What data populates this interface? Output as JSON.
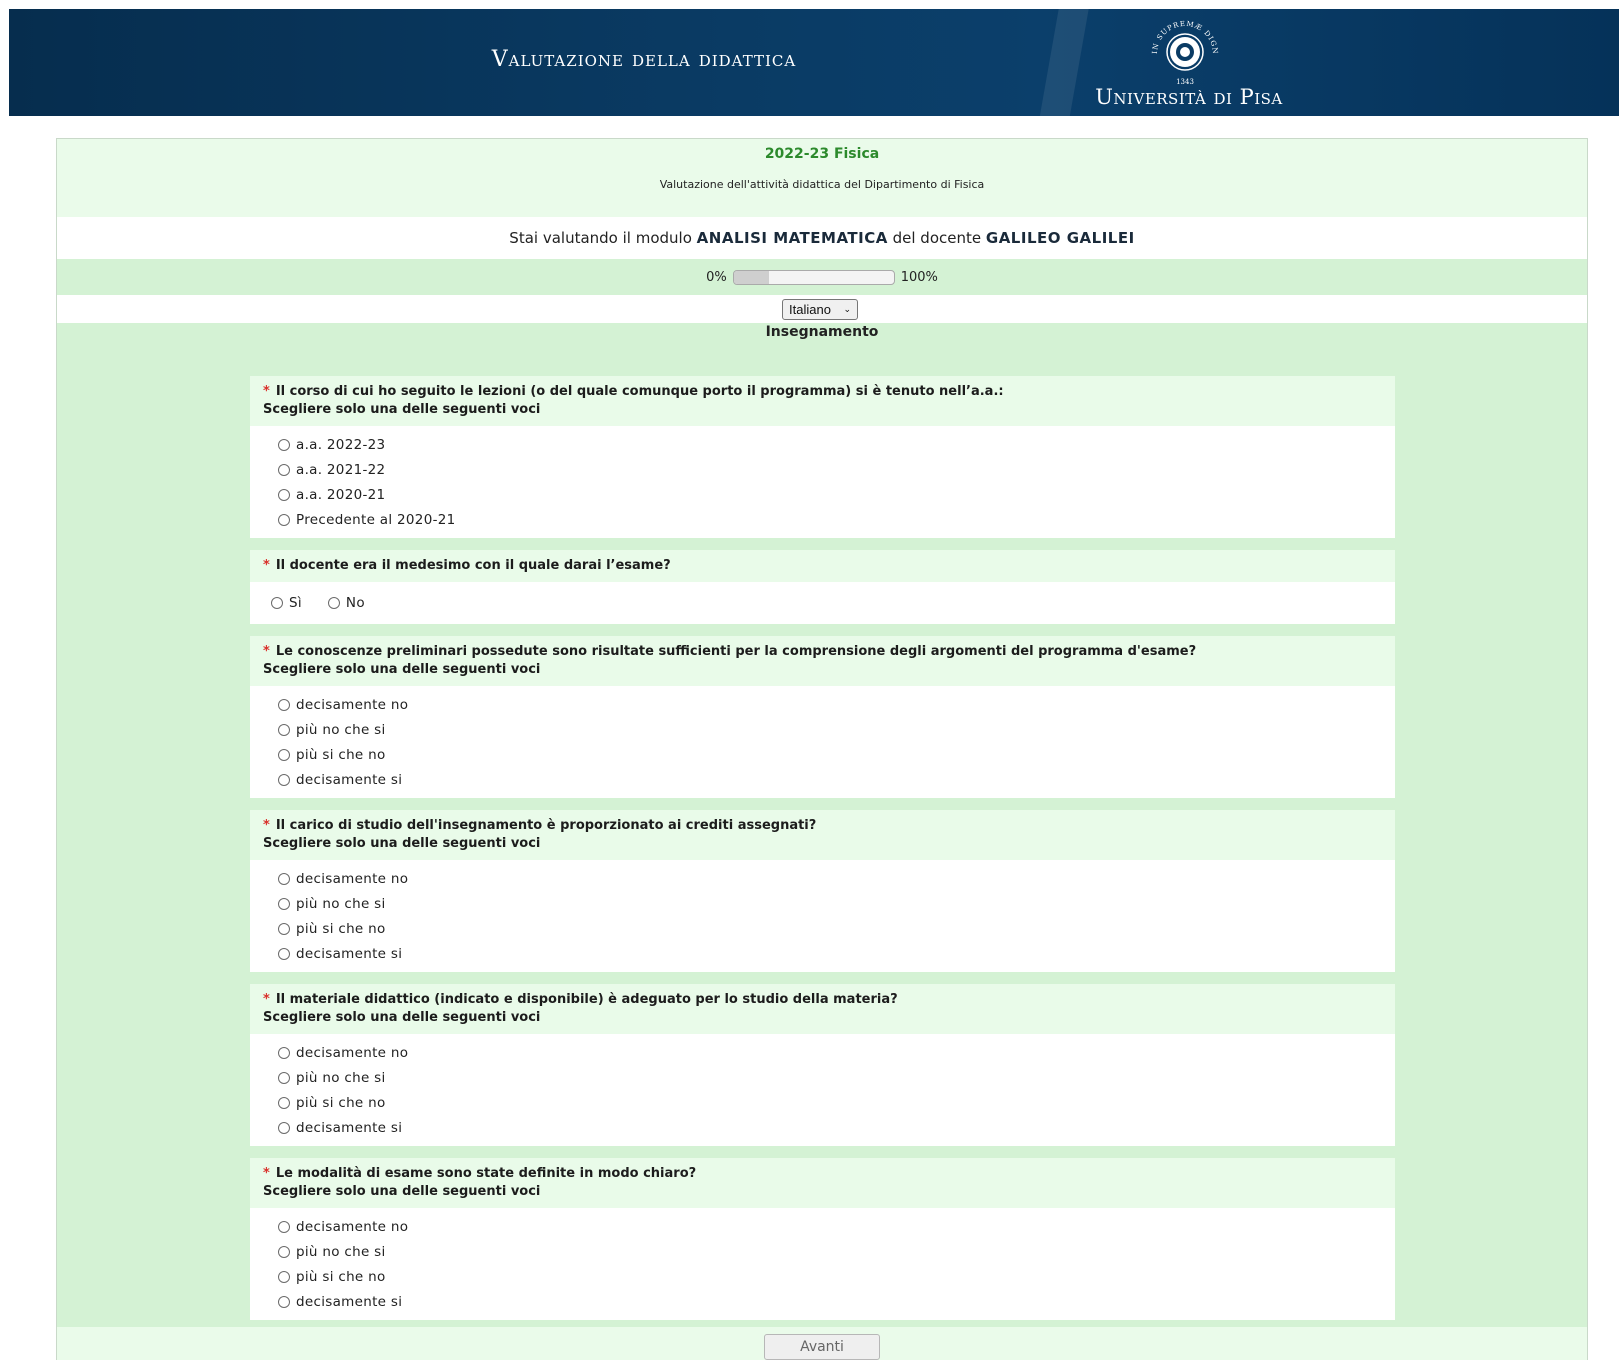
{
  "header": {
    "title": "Valutazione della didattica",
    "university": "Università di Pisa",
    "logo_motto": "IN SUPREMÆ DIGNITATIS",
    "logo_year": "1343"
  },
  "top": {
    "year_course": "2022-23 Fisica",
    "description": "Valutazione dell'attività didattica del Dipartimento di Fisica"
  },
  "evaluation": {
    "prefix": "Stai valutando il modulo",
    "module": "ANALISI MATEMATICA",
    "middle": "del docente",
    "teacher": "GALILEO GALILEI"
  },
  "progress": {
    "start_label": "0%",
    "end_label": "100%",
    "value": 0.22
  },
  "language": {
    "selected": "Italiano"
  },
  "section": {
    "title": "Insegnamento"
  },
  "questions": [
    {
      "text": "Il corso di cui  ho seguito le lezioni (o del quale comunque porto il programma) si è tenuto nell’a.a.:",
      "hint": "Scegliere solo una delle seguenti voci",
      "options": [
        "a.a. 2022-23",
        "a.a. 2021-22",
        "a.a. 2020-21",
        "Precedente al 2020-21"
      ]
    },
    {
      "text": "Il docente era il medesimo con il quale darai l’esame?",
      "options": [
        "Sì",
        "No"
      ]
    },
    {
      "text": "Le conoscenze preliminari possedute sono risultate sufficienti per la comprensione degli argomenti del programma d'esame?",
      "hint": "Scegliere solo una delle seguenti voci",
      "options": [
        "decisamente no",
        "più no che si",
        "più si che no",
        "decisamente si"
      ]
    },
    {
      "text": "Il carico di studio dell'insegnamento è proporzionato ai crediti assegnati?",
      "hint": "Scegliere solo una delle seguenti voci",
      "options": [
        "decisamente no",
        "più no che si",
        "più si che no",
        "decisamente si"
      ]
    },
    {
      "text": "Il materiale didattico (indicato e disponibile) è adeguato per lo studio della materia?",
      "hint": "Scegliere solo una delle seguenti voci",
      "options": [
        "decisamente no",
        "più no che si",
        "più si che no",
        "decisamente si"
      ]
    },
    {
      "text": "Le modalità di esame sono state definite in modo chiaro?",
      "hint": "Scegliere solo una delle seguenti voci",
      "options": [
        "decisamente no",
        "più no che si",
        "più si che no",
        "decisamente si"
      ]
    }
  ],
  "required_marker": "*",
  "footer": {
    "next_label": "Avanti"
  }
}
